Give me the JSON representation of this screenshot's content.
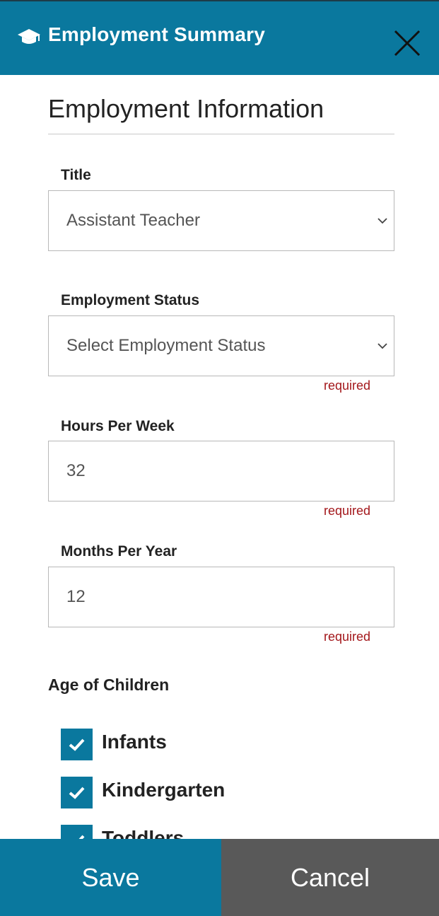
{
  "header": {
    "title": "Employment Summary",
    "icon": "graduation-cap-icon",
    "close_icon": "close-icon",
    "color": "#0a789e"
  },
  "section": {
    "title": "Employment Information"
  },
  "fields": {
    "title": {
      "label": "Title",
      "value": "Assistant Teacher"
    },
    "employment_status": {
      "label": "Employment Status",
      "value": "Select Employment Status",
      "validation": "required"
    },
    "hours_per_week": {
      "label": "Hours Per Week",
      "value": "32",
      "validation": "required"
    },
    "months_per_year": {
      "label": "Months Per Year",
      "value": "12",
      "validation": "required"
    }
  },
  "age_of_children": {
    "label": "Age of Children",
    "options": [
      {
        "label": "Infants",
        "checked": true
      },
      {
        "label": "Kindergarten",
        "checked": true
      },
      {
        "label": "Toddlers",
        "checked": true
      }
    ]
  },
  "footer": {
    "save_label": "Save",
    "cancel_label": "Cancel",
    "save_color": "#0a789e",
    "cancel_color": "#595959"
  },
  "colors": {
    "required_text": "#a3171b"
  }
}
